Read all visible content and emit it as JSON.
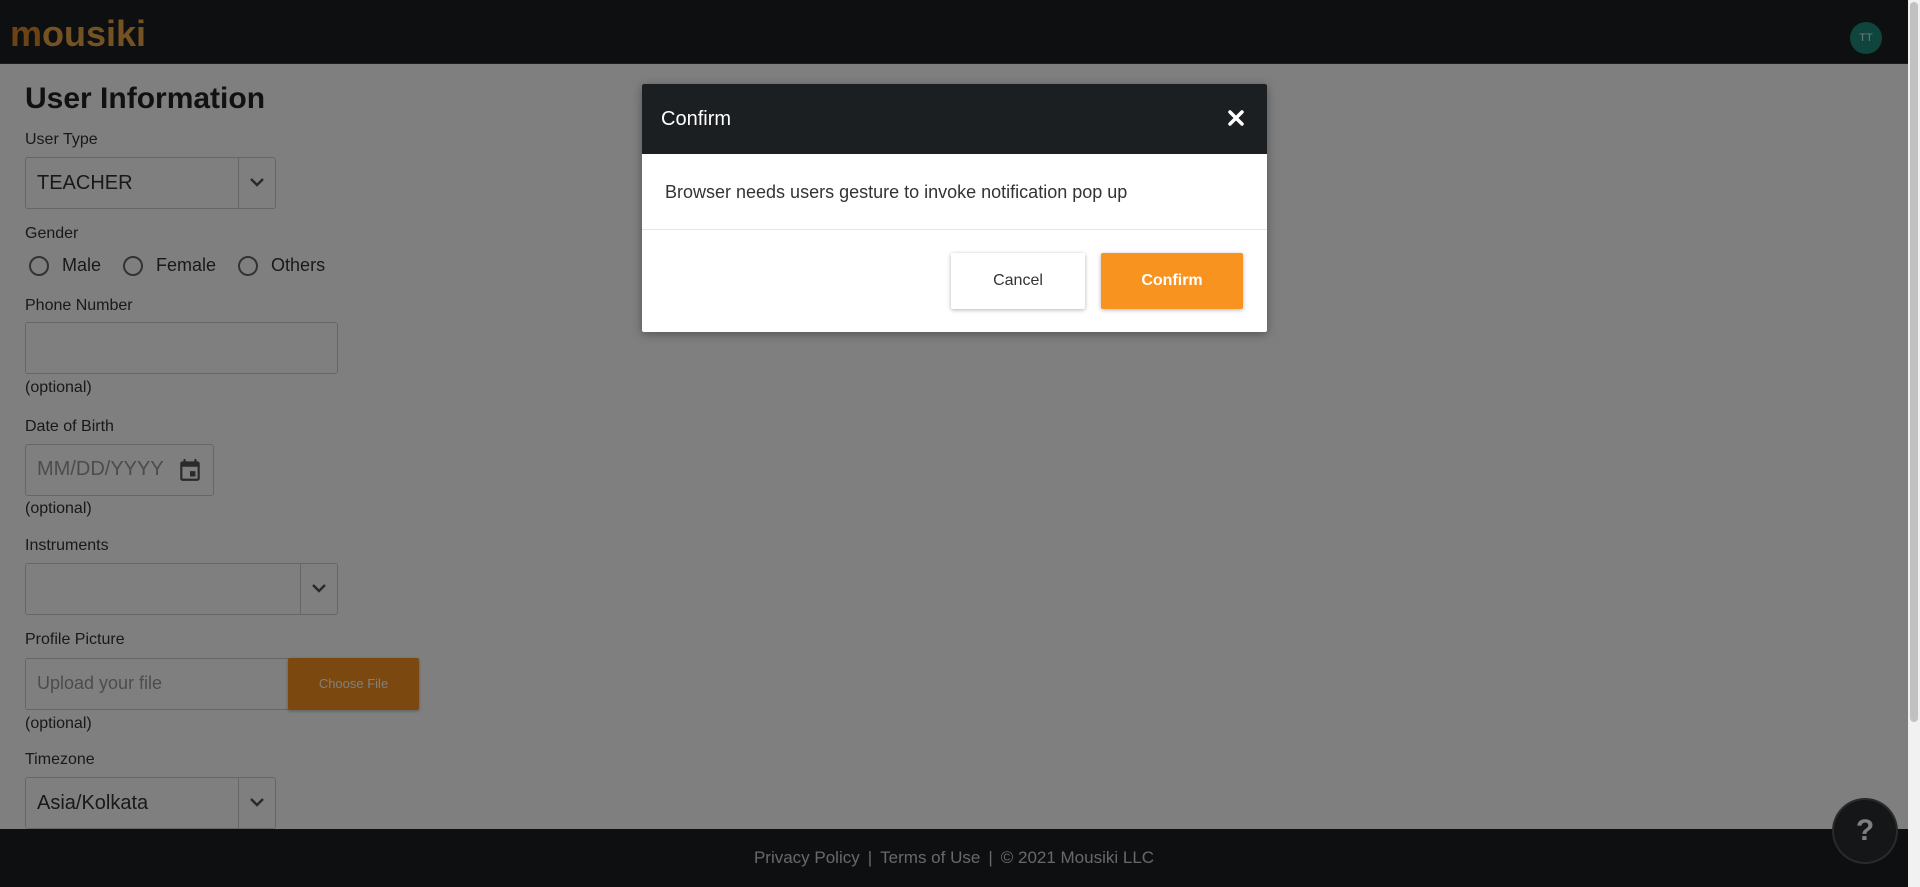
{
  "header": {
    "logo_first": "m",
    "logo_rest": "ousiki",
    "avatar_initials": "TT"
  },
  "form": {
    "title": "User Information",
    "user_type": {
      "label": "User Type",
      "value": "TEACHER"
    },
    "gender": {
      "label": "Gender",
      "options": [
        "Male",
        "Female",
        "Others"
      ]
    },
    "phone": {
      "label": "Phone Number",
      "value": "",
      "hint": "(optional)"
    },
    "dob": {
      "label": "Date of Birth",
      "placeholder": "MM/DD/YYYY",
      "hint": "(optional)"
    },
    "instruments": {
      "label": "Instruments",
      "value": ""
    },
    "profile_picture": {
      "label": "Profile Picture",
      "placeholder": "Upload your file",
      "button": "Choose File",
      "hint": "(optional)"
    },
    "timezone": {
      "label": "Timezone",
      "value": "Asia/Kolkata"
    }
  },
  "footer": {
    "privacy": "Privacy Policy",
    "terms": "Terms of Use",
    "copyright": "© 2021 Mousiki LLC",
    "separator": "|"
  },
  "help": {
    "label": "?"
  },
  "modal": {
    "title": "Confirm",
    "message": "Browser needs users gesture to invoke notification pop up",
    "cancel_label": "Cancel",
    "confirm_label": "Confirm"
  },
  "colors": {
    "accent": "#f7931e",
    "dark": "#1c1f22",
    "avatar": "#1f8a7a"
  }
}
